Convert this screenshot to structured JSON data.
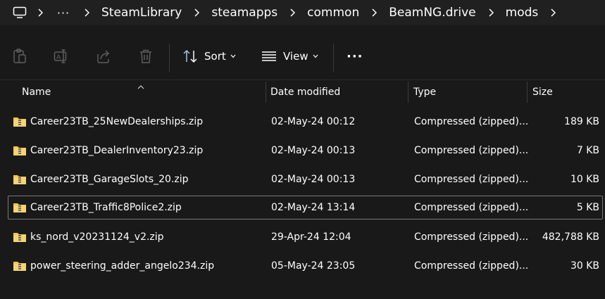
{
  "breadcrumb": {
    "more": "···",
    "items": [
      "SteamLibrary",
      "steamapps",
      "common",
      "BeamNG.drive",
      "mods"
    ]
  },
  "toolbar": {
    "sort_label": "Sort",
    "view_label": "View",
    "more_label": "···"
  },
  "columns": {
    "name": "Name",
    "date": "Date modified",
    "type": "Type",
    "size": "Size"
  },
  "files": [
    {
      "name": "Career23TB_25NewDealerships.zip",
      "date": "02-May-24 00:12",
      "type": "Compressed (zipped)...",
      "size": "189 KB"
    },
    {
      "name": "Career23TB_DealerInventory23.zip",
      "date": "02-May-24 00:13",
      "type": "Compressed (zipped)...",
      "size": "7 KB"
    },
    {
      "name": "Career23TB_GarageSlots_20.zip",
      "date": "02-May-24 00:13",
      "type": "Compressed (zipped)...",
      "size": "10 KB"
    },
    {
      "name": "Career23TB_Traffic8Police2.zip",
      "date": "02-May-24 13:14",
      "type": "Compressed (zipped)...",
      "size": "5 KB"
    },
    {
      "name": "ks_nord_v20231124_v2.zip",
      "date": "29-Apr-24 12:04",
      "type": "Compressed (zipped)...",
      "size": "482,788 KB"
    },
    {
      "name": "power_steering_adder_angelo234.zip",
      "date": "05-May-24 23:05",
      "type": "Compressed (zipped)...",
      "size": "30 KB"
    }
  ],
  "colors": {
    "background": "#191919",
    "address_bar": "#202020",
    "folder_yellow": "#f6c64a",
    "disabled_icon": "#5e5e5e",
    "accent_icon": "#9fc4ea"
  }
}
